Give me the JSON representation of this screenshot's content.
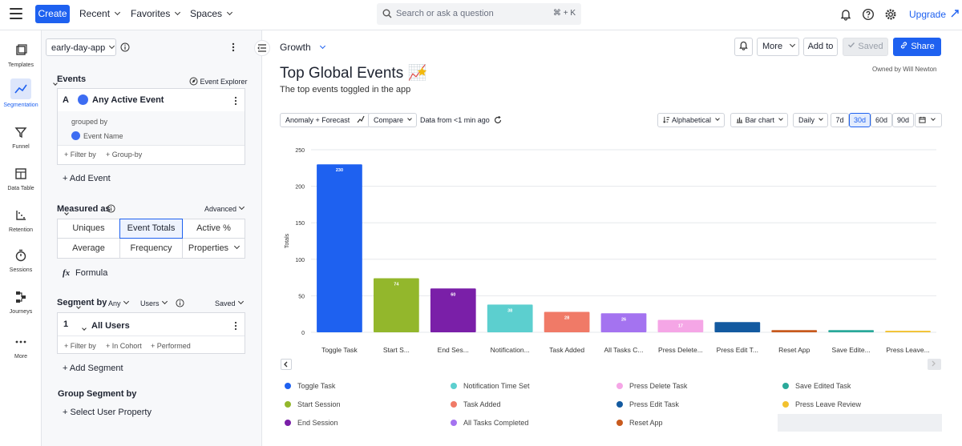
{
  "topbar": {
    "create": "Create",
    "recent": "Recent",
    "favorites": "Favorites",
    "spaces": "Spaces",
    "search_placeholder": "Search or ask a question",
    "search_shortcut": "⌘ + K",
    "upgrade": "Upgrade"
  },
  "rail": {
    "items": [
      {
        "label": "Templates",
        "icon": "templates-icon"
      },
      {
        "label": "Segmentation",
        "icon": "segmentation-icon"
      },
      {
        "label": "Funnel",
        "icon": "funnel-icon"
      },
      {
        "label": "Data Table",
        "icon": "data-table-icon"
      },
      {
        "label": "Retention",
        "icon": "retention-icon"
      },
      {
        "label": "Sessions",
        "icon": "sessions-icon"
      },
      {
        "label": "Journeys",
        "icon": "journeys-icon"
      },
      {
        "label": "More",
        "icon": "more-icon"
      }
    ]
  },
  "panel": {
    "project": "early-day-app",
    "events_heading": "Events",
    "event_explorer": "Event Explorer",
    "event_letter": "A",
    "event_name": "Any Active Event",
    "grouped_by": "grouped by",
    "group_prop": "Event Name",
    "filter_by": "+ Filter by",
    "group_by": "+ Group-by",
    "add_event": "+ Add Event",
    "measured_as": "Measured as",
    "advanced": "Advanced",
    "measures": [
      "Uniques",
      "Event Totals",
      "Active %",
      "Average",
      "Frequency",
      "Properties"
    ],
    "formula": "Formula",
    "segment_by": "Segment by",
    "segment_any": "Any",
    "segment_users": "Users",
    "saved": "Saved",
    "segment_num": "1",
    "segment_name": "All Users",
    "seg_filter": "+ Filter by",
    "seg_cohort": "+ In Cohort",
    "seg_performed": "+ Performed",
    "add_segment": "+ Add Segment",
    "group_segment_by": "Group Segment by",
    "select_user_property": "+ Select User Property"
  },
  "main": {
    "space": "Growth",
    "more": "More",
    "add_to": "Add to",
    "saved": "Saved",
    "share": "Share",
    "title": "Top Global Events 📈",
    "owned_by": "Owned by Will Newton",
    "description": "The top events toggled in the app",
    "anomaly": "Anomaly + Forecast",
    "compare": "Compare",
    "data_from": "Data from <1 min ago",
    "sort": "Alphabetical",
    "chart_type": "Bar chart",
    "interval": "Daily",
    "ranges": [
      "7d",
      "30d",
      "60d",
      "90d"
    ],
    "selected_range": "30d"
  },
  "chart_data": {
    "type": "bar",
    "ylabel": "Totals",
    "ylim": [
      0,
      250
    ],
    "yticks": [
      0,
      50,
      100,
      150,
      200,
      250
    ],
    "categories": [
      "Toggle Task",
      "Start Session",
      "End Session",
      "Notification Time Set",
      "Task Added",
      "All Tasks Completed",
      "Press Delete Task",
      "Press Edit Task",
      "Reset App",
      "Save Edited Task",
      "Press Leave Review"
    ],
    "tick_labels": [
      "Toggle Task",
      "Start S...",
      "End Ses...",
      "Notification...",
      "Task Added",
      "All Tasks C...",
      "Press Delete...",
      "Press Edit T...",
      "Reset App",
      "Save Edite...",
      "Press Leave..."
    ],
    "values": [
      230,
      74,
      60,
      38,
      28,
      26,
      17,
      14,
      3,
      3,
      2
    ],
    "data_labels": [
      "230",
      "74",
      "60",
      "38",
      "28",
      "26",
      "17",
      "",
      "",
      "",
      ""
    ],
    "colors": [
      "#1e61f0",
      "#93b72c",
      "#7a1fa8",
      "#5ccfcf",
      "#f07a67",
      "#a473f0",
      "#f5a6e6",
      "#135aa0",
      "#c85a1e",
      "#2aa99a",
      "#f2c12e"
    ],
    "legend": [
      "Toggle Task",
      "Start Session",
      "End Session",
      "Notification Time Set",
      "Task Added",
      "All Tasks Completed",
      "Press Delete Task",
      "Press Edit Task",
      "Reset App",
      "Save Edited Task",
      "Press Leave Review"
    ]
  }
}
